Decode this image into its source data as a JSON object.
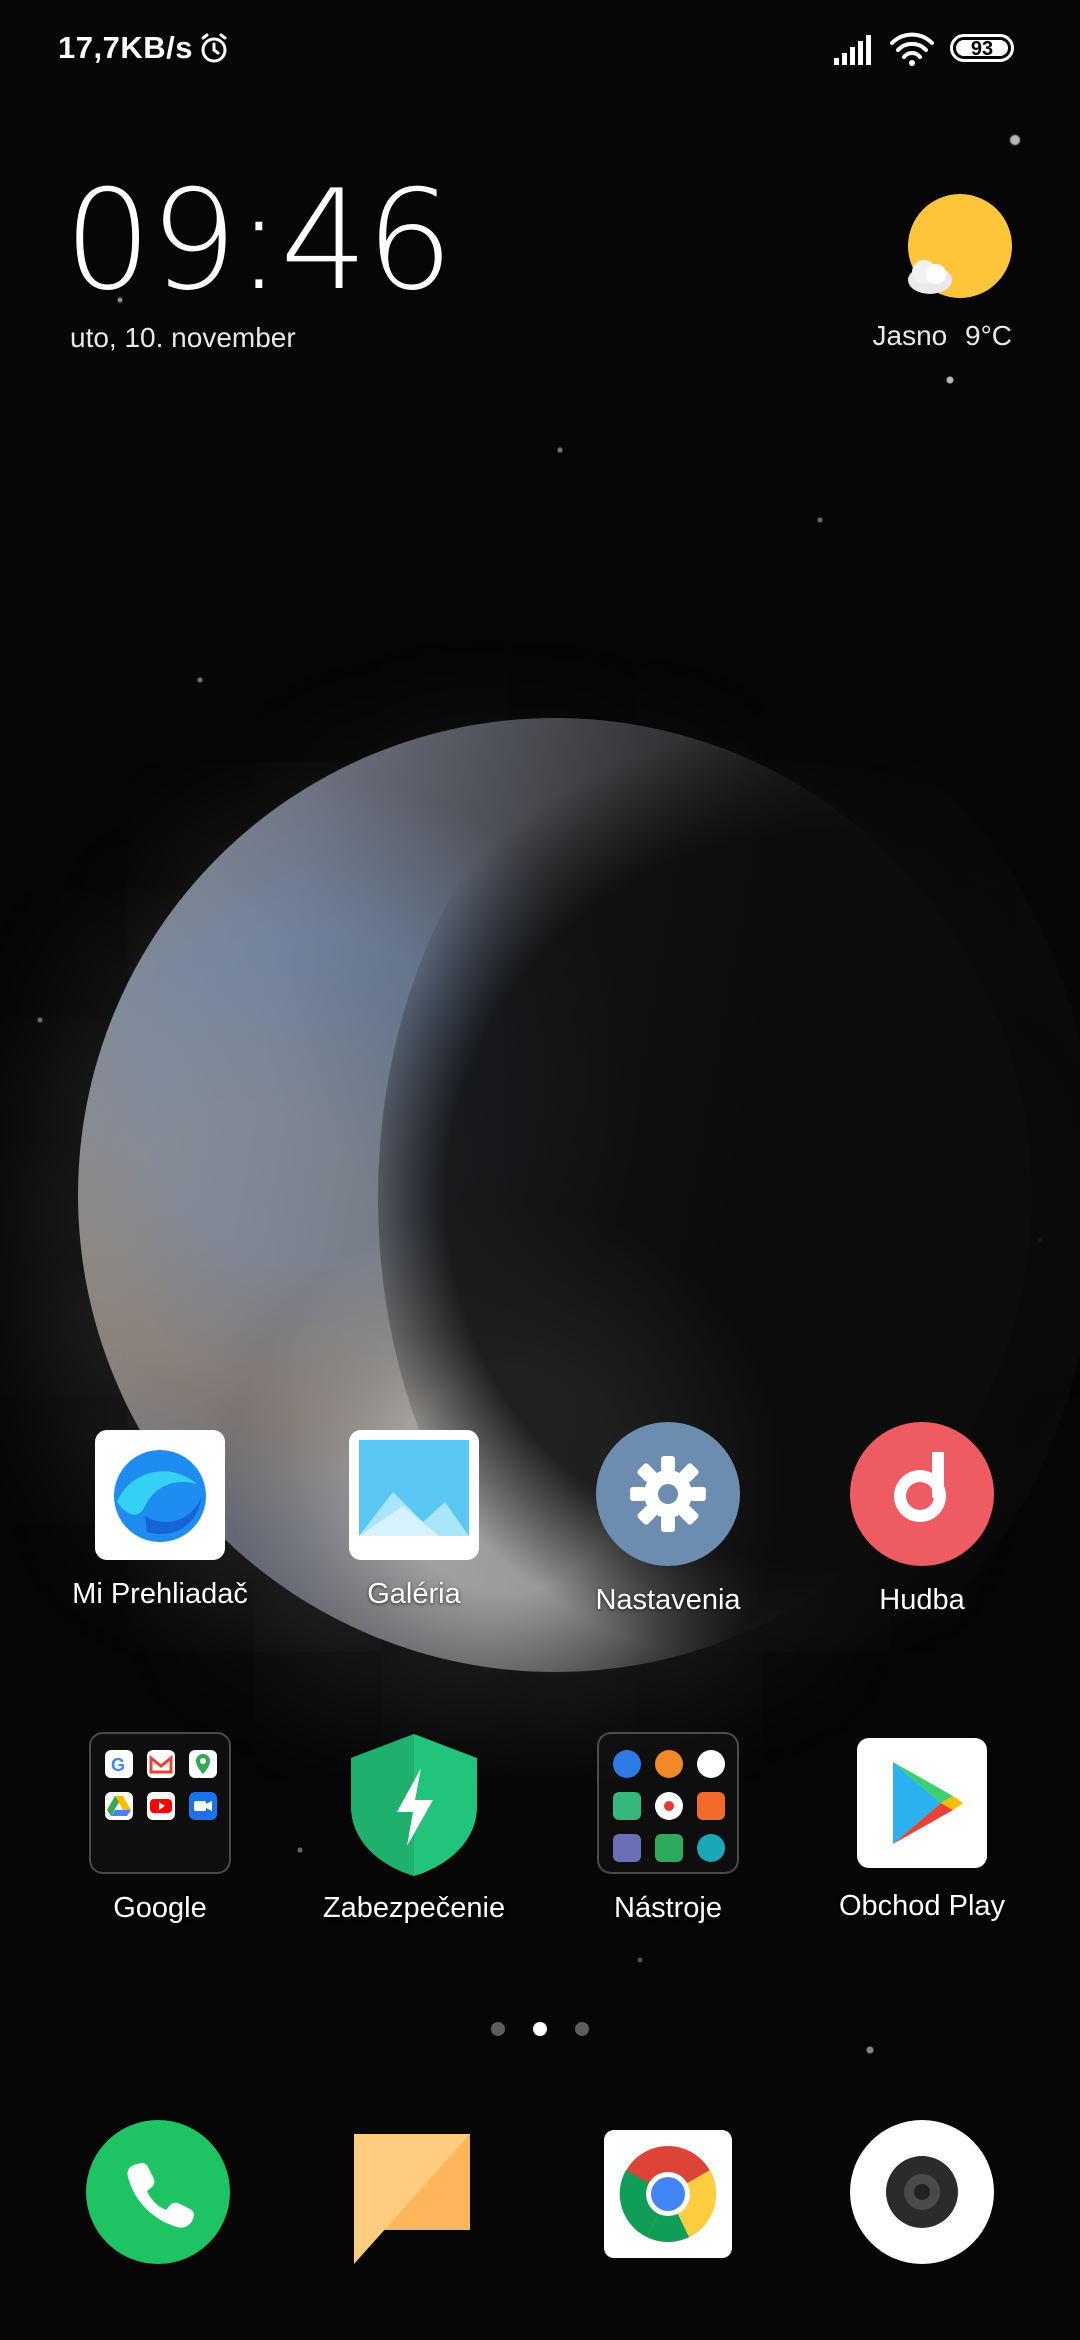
{
  "status_bar": {
    "net_speed": "17,7KB/s",
    "battery": "93"
  },
  "clock": {
    "time": "09:46",
    "date": "uto, 10. november"
  },
  "weather": {
    "condition": "Jasno",
    "temp": "9°C"
  },
  "apps_row1": [
    {
      "label": "Mi Prehliadač",
      "icon": "mi-browser-icon"
    },
    {
      "label": "Galéria",
      "icon": "gallery-icon"
    },
    {
      "label": "Nastavenia",
      "icon": "settings-gear-icon"
    },
    {
      "label": "Hudba",
      "icon": "music-note-icon"
    }
  ],
  "apps_row2": [
    {
      "label": "Google",
      "icon": "google-folder-icon"
    },
    {
      "label": "Zabezpečenie",
      "icon": "security-shield-icon"
    },
    {
      "label": "Nástroje",
      "icon": "tools-folder-icon"
    },
    {
      "label": "Obchod Play",
      "icon": "play-store-icon"
    }
  ],
  "dock": [
    "phone-icon",
    "messages-icon",
    "chrome-icon",
    "camera-icon"
  ],
  "page_indicator": {
    "count": 3,
    "active": 2
  },
  "colors": {
    "phone": "#1ec464",
    "music": "#ef5b63",
    "settings": "#6d8db0",
    "security": "#22c37a",
    "messages": "#ffb55a"
  }
}
